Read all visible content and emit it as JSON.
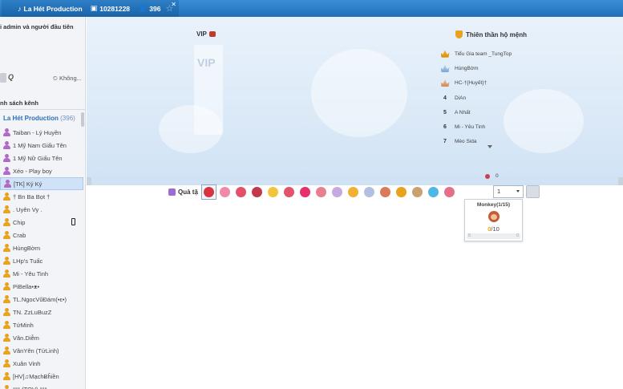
{
  "tab": {
    "title": "La Hét Production",
    "room_id": "10281228",
    "users": "396"
  },
  "sidebar": {
    "top_text": "i admin và người đầu tiên",
    "tool_label": "Không...",
    "section_title": "nh sách kênh",
    "channel_name": "La Hét Production",
    "channel_count": "(396)",
    "users": [
      {
        "name": "Taiban - Lý Huyền",
        "color": "#b06ac6"
      },
      {
        "name": "1 Mỹ Nam Giấu Tên",
        "color": "#b06ac6"
      },
      {
        "name": "1 Mỹ Nữ Giấu Tên",
        "color": "#b06ac6"
      },
      {
        "name": "Xéo - Play boy",
        "color": "#b06ac6"
      },
      {
        "name": "[TK] Ký Ký",
        "color": "#b06ac6",
        "selected": true
      },
      {
        "name": "† Bn Ba Bọt †",
        "color": "#e8a21c"
      },
      {
        "name": ". Uyên Vy .",
        "color": "#e8a21c"
      },
      {
        "name": "Chip",
        "color": "#e8a21c",
        "phone": true
      },
      {
        "name": "Crab",
        "color": "#e8a21c"
      },
      {
        "name": "HùngBờm",
        "color": "#e8a21c"
      },
      {
        "name": "LHp's Tuấc",
        "color": "#e8a21c"
      },
      {
        "name": "Mi - Yêu Tinh",
        "color": "#e8a21c"
      },
      {
        "name": "PiBella•ᴥ•",
        "color": "#e8a21c"
      },
      {
        "name": "TL.NgocVũĐám(•ε•)",
        "color": "#e8a21c"
      },
      {
        "name": "TN. ZzLuBuzZ",
        "color": "#e8a21c"
      },
      {
        "name": "TứMinh",
        "color": "#e8a21c"
      },
      {
        "name": "Vân.Diễm",
        "color": "#e8a21c"
      },
      {
        "name": "VânYên (TửLinh)",
        "color": "#e8a21c"
      },
      {
        "name": "Xuân Vinh",
        "color": "#e8a21c"
      },
      {
        "name": "[HV]♫MạchɃĥiền",
        "color": "#e8a21c"
      },
      {
        "name": "°°° (TQV) °°°",
        "color": "#e8a21c"
      }
    ]
  },
  "stage": {
    "vip_title": "VIP",
    "guard_title": "Thiên thần hộ mệnh",
    "guards": [
      {
        "rank": "crown",
        "name": "Tiểu Gia team _TungTop"
      },
      {
        "rank": "crown2",
        "name": "HùngBờm"
      },
      {
        "rank": "crown3",
        "name": "HC-†{Huyết}†"
      },
      {
        "rank": "4",
        "name": "DiAn"
      },
      {
        "rank": "5",
        "name": "A Nhất"
      },
      {
        "rank": "6",
        "name": "Mi - Yêu Tinh"
      },
      {
        "rank": "7",
        "name": "Mèo Sida"
      }
    ],
    "rose_count": "0"
  },
  "giftbar": {
    "label": "Quà tặ",
    "quantity": "1",
    "gift_colors": [
      "#d8343f",
      "#f08aa8",
      "#e2506a",
      "#c0394e",
      "#f2c53d",
      "#e0556b",
      "#e8306a",
      "#e77f90",
      "#c7a8e0",
      "#f0b030",
      "#b0c0e0",
      "#d97a5a",
      "#e8a21c",
      "#c9a070",
      "#4fb6e8",
      "#e3708a"
    ]
  },
  "popup": {
    "title": "Monkey(1/15)",
    "current": "0",
    "total": "/10",
    "level_start": "0",
    "level_end": "0"
  }
}
